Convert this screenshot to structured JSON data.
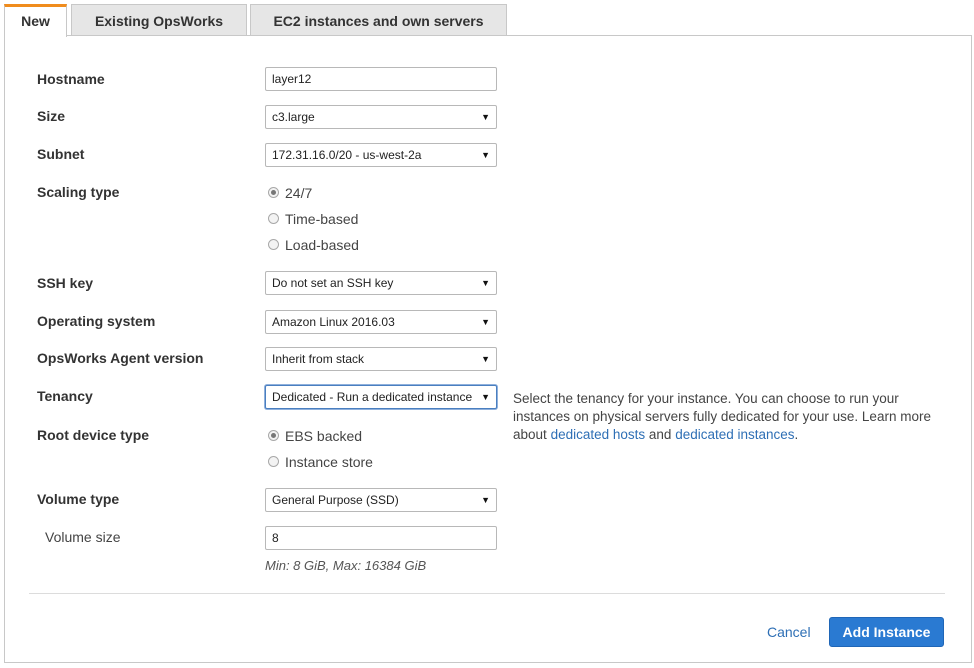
{
  "tabs": [
    {
      "label": "New",
      "active": true
    },
    {
      "label": "Existing OpsWorks",
      "active": false
    },
    {
      "label": "EC2 instances and own servers",
      "active": false
    }
  ],
  "form": {
    "hostname": {
      "label": "Hostname",
      "value": "layer12"
    },
    "size": {
      "label": "Size",
      "value": "c3.large"
    },
    "subnet": {
      "label": "Subnet",
      "value": "172.31.16.0/20 - us-west-2a"
    },
    "scaling_type": {
      "label": "Scaling type",
      "options": [
        "24/7",
        "Time-based",
        "Load-based"
      ],
      "selected": "24/7"
    },
    "ssh_key": {
      "label": "SSH key",
      "value": "Do not set an SSH key"
    },
    "operating_system": {
      "label": "Operating system",
      "value": "Amazon Linux 2016.03"
    },
    "agent_version": {
      "label": "OpsWorks Agent version",
      "value": "Inherit from stack"
    },
    "tenancy": {
      "label": "Tenancy",
      "value": "Dedicated - Run a dedicated instance",
      "help_text": "Select the tenancy for your instance. You can choose to run your instances on physical servers fully dedicated for your use. Learn more about",
      "link_hosts": "dedicated hosts",
      "and_text": "and",
      "link_instances": "dedicated instances",
      "period": "."
    },
    "root_device_type": {
      "label": "Root device type",
      "options": [
        "EBS backed",
        "Instance store"
      ],
      "selected": "EBS backed"
    },
    "volume_type": {
      "label": "Volume type",
      "value": "General Purpose (SSD)"
    },
    "volume_size": {
      "label": "Volume size",
      "value": "8",
      "hint": "Min: 8 GiB, Max: 16384 GiB"
    }
  },
  "actions": {
    "cancel": "Cancel",
    "submit": "Add Instance"
  },
  "colors": {
    "accent_tab": "#f08c1d",
    "primary_button": "#2a7ad2",
    "link": "#2e6fb5"
  },
  "icons": {
    "select_caret": "caret-down-icon",
    "radio": "radio-icon"
  }
}
